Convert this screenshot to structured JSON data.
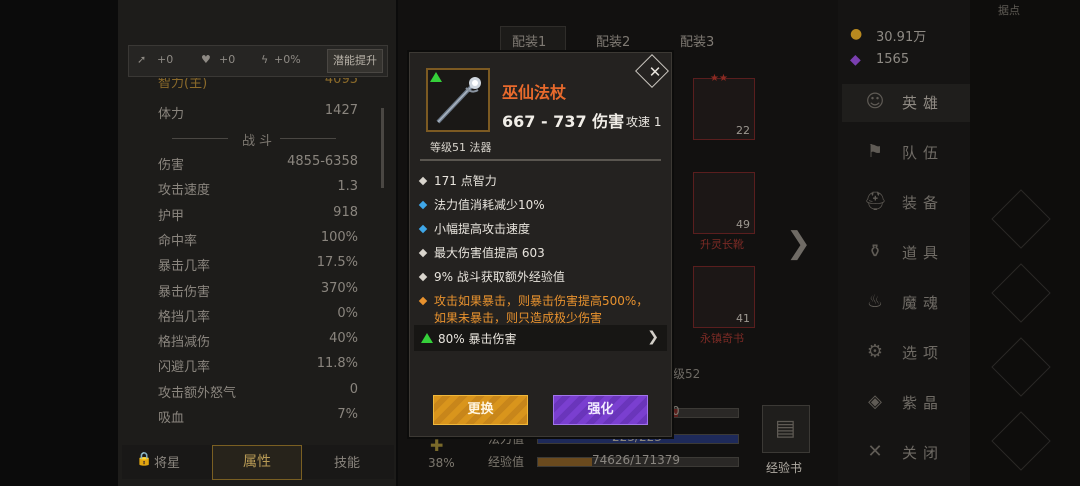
{
  "left_panel": {
    "top_bar": {
      "item1": "+0",
      "item2": "+0",
      "item3": "+0%",
      "button": "潜能提升"
    },
    "stat_partial_top": {
      "label": "智力(主)",
      "value": "4095"
    },
    "stats_top": [
      {
        "label": "体力",
        "value": "1427"
      }
    ],
    "section_title": "战斗",
    "stats": [
      {
        "label": "伤害",
        "value": "4855-6358"
      },
      {
        "label": "攻击速度",
        "value": "1.3"
      },
      {
        "label": "护甲",
        "value": "918"
      },
      {
        "label": "命中率",
        "value": "100%"
      },
      {
        "label": "暴击几率",
        "value": "17.5%"
      },
      {
        "label": "暴击伤害",
        "value": "370%"
      },
      {
        "label": "格挡几率",
        "value": "0%"
      },
      {
        "label": "格挡减伤",
        "value": "40%"
      },
      {
        "label": "闪避几率",
        "value": "11.8%"
      },
      {
        "label": "攻击额外怒气",
        "value": "0"
      },
      {
        "label": "吸血",
        "value": "7%"
      }
    ],
    "bottom_tabs": {
      "tab1": "将星",
      "tab2": "属性",
      "tab3": "技能"
    }
  },
  "middle": {
    "loadout_tabs": [
      "配装1",
      "配装2",
      "配装3"
    ],
    "slots": [
      {
        "level": "22",
        "label": ""
      },
      {
        "level": "49",
        "label": "升灵长靴"
      },
      {
        "level": "41",
        "label": "永镇奇书"
      }
    ],
    "level_text": "级52",
    "percent": "38%",
    "bars": [
      {
        "label": "",
        "text": "0"
      },
      {
        "label": "法力值",
        "text": "223/223"
      },
      {
        "label": "经验值",
        "text": "74626/171379"
      }
    ],
    "exp_book_label": "经验书"
  },
  "right_menu": {
    "currency": {
      "gold": "30.91万",
      "gems": "1565"
    },
    "id_text": "",
    "items": [
      {
        "label": "英雄",
        "icon": "person-icon"
      },
      {
        "label": "队伍",
        "icon": "flag-icon"
      },
      {
        "label": "装备",
        "icon": "helmet-icon"
      },
      {
        "label": "道具",
        "icon": "bag-icon"
      },
      {
        "label": "魔魂",
        "icon": "flame-icon"
      },
      {
        "label": "选项",
        "icon": "gear-icon"
      },
      {
        "label": "紫晶",
        "icon": "crystal-icon"
      },
      {
        "label": "关闭",
        "icon": "close-icon"
      }
    ],
    "far_right_label": "据点"
  },
  "modal": {
    "item_name": "巫仙法杖",
    "damage": "667 - 737 伤害",
    "attack_speed": "攻速 1",
    "level_type": "等级51 法器",
    "affixes": [
      {
        "text": "171 点智力",
        "bullet": "#d9d5cd",
        "style": "normal"
      },
      {
        "text": "法力值消耗减少10%",
        "bullet": "#3fa7e8",
        "style": "normal"
      },
      {
        "text": "小幅提高攻击速度",
        "bullet": "#3fa7e8",
        "style": "normal"
      },
      {
        "text": "最大伤害值提高 603",
        "bullet": "#d9d5cd",
        "style": "normal"
      },
      {
        "text": "9% 战斗获取额外经验值",
        "bullet": "#d9d5cd",
        "style": "normal"
      },
      {
        "text": "攻击如果暴击，则暴击伤害提高500%，",
        "text2": "如果未暴击，则只造成极少伤害",
        "bullet": "#e8922e",
        "style": "orange"
      }
    ],
    "socket_text": "80% 暴击伤害",
    "buttons": {
      "replace": "更换",
      "enhance": "强化"
    }
  }
}
